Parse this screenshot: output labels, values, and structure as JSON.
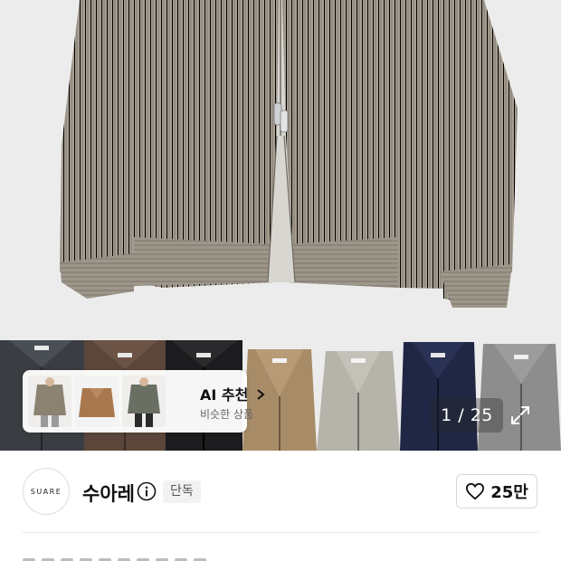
{
  "hero": {
    "product_image": "knit-zip-cardigan-photo",
    "colors": {
      "knit": "#a59e91",
      "background": "#ececec"
    }
  },
  "color_swatches": [
    {
      "name": "charcoal",
      "color": "#3a3d42"
    },
    {
      "name": "brown",
      "color": "#5a463a"
    },
    {
      "name": "black",
      "color": "#1c1c1e"
    },
    {
      "name": "camel",
      "color": "#a88c68"
    },
    {
      "name": "light-grey",
      "color": "#b6b3aa"
    },
    {
      "name": "navy",
      "color": "#1f2744"
    },
    {
      "name": "grey",
      "color": "#8d8d8d"
    }
  ],
  "ai_recommend": {
    "title": "AI 추천",
    "subtitle": "비슷한 상품",
    "chevron": "chevron-right-icon"
  },
  "gallery": {
    "counter": "1 / 25",
    "expand_icon": "expand-icon"
  },
  "brand": {
    "logo_text": "SUARE",
    "name": "수아레",
    "badge": "단독",
    "info_icon": "info-icon"
  },
  "like": {
    "icon": "heart-icon",
    "count": "25만"
  }
}
